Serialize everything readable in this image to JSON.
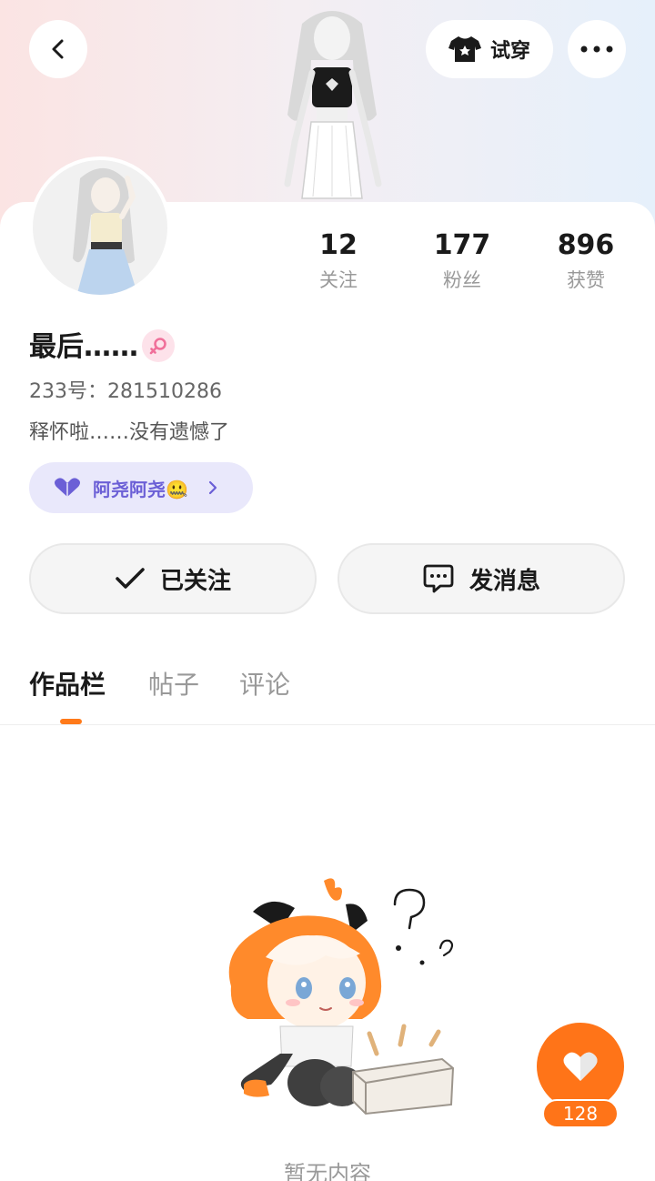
{
  "header": {
    "try_on_label": "试穿",
    "back_icon": "chevron-left-icon",
    "more_icon": "more-dots-icon",
    "try_on_icon": "tshirt-icon"
  },
  "profile": {
    "username": "最后……",
    "gender": "female",
    "uid": "233号：281510286",
    "bio": "释怀啦……没有遗憾了",
    "tag": {
      "label": "阿尧阿尧",
      "emoji": "🤐",
      "icon": "heart-icon"
    }
  },
  "stats": [
    {
      "value": "12",
      "label": "关注"
    },
    {
      "value": "177",
      "label": "粉丝"
    },
    {
      "value": "896",
      "label": "获赞"
    }
  ],
  "actions": {
    "follow_label": "已关注",
    "message_label": "发消息"
  },
  "tabs": [
    {
      "label": "作品栏",
      "active": true
    },
    {
      "label": "帖子",
      "active": false
    },
    {
      "label": "评论",
      "active": false
    }
  ],
  "empty_state": {
    "text": "暂无内容"
  },
  "like_fab": {
    "count": "128"
  },
  "colors": {
    "accent": "#ff7418",
    "tag_text": "#6b5fd6",
    "tag_bg": "#e9e8fb"
  }
}
